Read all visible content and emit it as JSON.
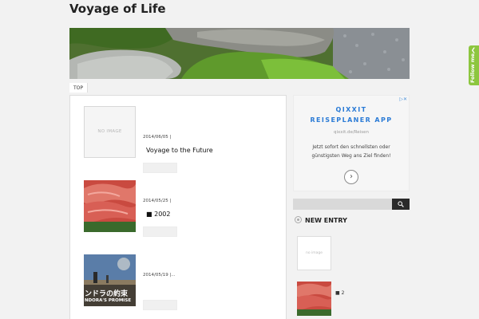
{
  "site": {
    "title": "Voyage of Life"
  },
  "breadcrumb": {
    "top_label": "TOP"
  },
  "posts": [
    {
      "thumb": "NO IMAGE",
      "date": "2014/06/05 |",
      "title": "Voyage to the Future"
    },
    {
      "thumb": "",
      "date": "2014/05/25 |",
      "title": "■ 2002"
    },
    {
      "thumb": "",
      "date": "2014/05/19 |...",
      "title": ""
    }
  ],
  "thumb_overlay": {
    "jp": "ンドラの約束",
    "en": "NDORA'S PROMISE"
  },
  "ad": {
    "close": "▷✕",
    "title_line1": "QIXXIT",
    "title_line2": "REISEPLANER APP",
    "url": "qixxit.de/Reisen",
    "text": "Jetzt sofort den schnellsten oder günstigsten Weg ans Ziel finden!",
    "arrow": "›"
  },
  "search": {
    "placeholder": "",
    "button_icon": "search-icon"
  },
  "new_entry": {
    "heading": "NEW ENTRY",
    "items": [
      {
        "thumb": "no image",
        "title": ""
      },
      {
        "thumb": "",
        "title": "■ 2"
      }
    ]
  },
  "follow": {
    "label": "Follow me",
    "icon": "feedly-icon"
  },
  "colors": {
    "follow_green": "#8dc63f",
    "ad_blue": "#2b7bd6"
  }
}
